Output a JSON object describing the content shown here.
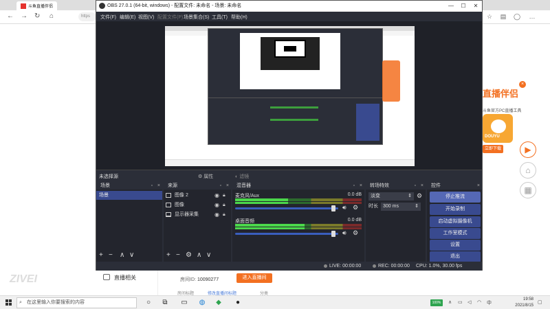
{
  "browser": {
    "tab_title": "斗鱼直播伴侣",
    "url_fragment": "https",
    "ad": {
      "title": "直播伴侣",
      "subtitle": "斗鱼官方PC直播工具",
      "brand": "DOUYU",
      "download": "立即下载",
      "close": "×",
      "brand_color": "#f37021"
    },
    "watermark": "ZIVEI",
    "menu_live": "直播相关",
    "room_id_label": "房间ID:",
    "room_id_value": "10090277",
    "go_live": "进入直播间",
    "stub1": "房间标题",
    "stub2": "修改直播间标题",
    "stub3": "分类"
  },
  "obs": {
    "title": "OBS 27.0.1 (64-bit, windows) - 配置文件: 未命名 - 场景: 未命名",
    "menu": [
      "文件(F)",
      "编辑(E)",
      "视图(V)",
      "配置文件(P)",
      "场景集合(S)",
      "工具(T)",
      "帮助(H)"
    ],
    "no_source_selected": "未选择源",
    "properties": "属性",
    "filters": "滤镜",
    "docks": {
      "scenes": "场景",
      "sources": "来源",
      "mixer": "混音器",
      "transitions": "转场特效",
      "controls": "控件"
    },
    "scenes": [
      "场景"
    ],
    "sources": [
      {
        "name": "图像 2",
        "icon": "image-icon"
      },
      {
        "name": "图像",
        "icon": "image-icon"
      },
      {
        "name": "显示器采集",
        "icon": "monitor-icon"
      }
    ],
    "mixer": [
      {
        "name": "麦克风/Aux",
        "db": "0.0 dB",
        "level": 0.42,
        "volume": 0.95
      },
      {
        "name": "桌面音频",
        "db": "0.0 dB",
        "level": 0.55,
        "volume": 0.95
      }
    ],
    "transition": {
      "type": "淡变",
      "duration_label": "时长",
      "duration_value": "300 ms"
    },
    "controls": [
      "停止推流",
      "开始录制",
      "启动虚拟摄像机",
      "工作室模式",
      "设置",
      "退出"
    ],
    "status": {
      "live": "LIVE: 00:00:00",
      "rec": "REC: 00:00:00",
      "cpu": "CPU: 1.0%, 30.00 fps"
    },
    "footer_glyphs": {
      "add": "+",
      "remove": "−",
      "up": "∧",
      "down": "∨",
      "gear": "⚙"
    }
  },
  "taskbar": {
    "search_placeholder": "在这里输入你要搜索的内容",
    "battery": "100%",
    "time": "19:58",
    "date": "2021/8/15",
    "ime": "中"
  }
}
